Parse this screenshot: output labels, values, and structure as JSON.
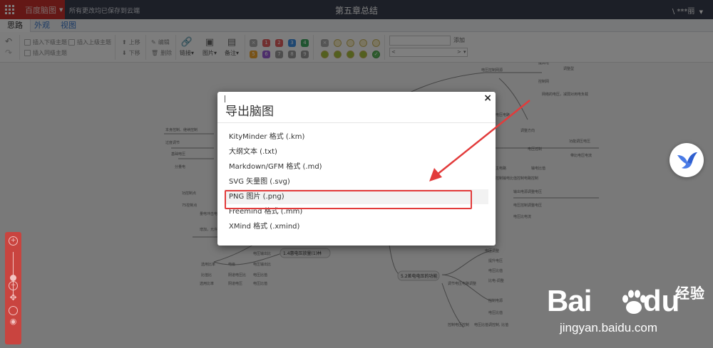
{
  "titlebar": {
    "brand": "百度脑图",
    "save_status": "所有更改均已保存到云端",
    "doc_title": "第五章总结",
    "user": "\\ ***丽"
  },
  "tabs": [
    {
      "label": "思路",
      "active": true
    },
    {
      "label": "外观",
      "active": false
    },
    {
      "label": "视图",
      "active": false
    }
  ],
  "toolbar": {
    "insert_child": "插入下级主题",
    "insert_parent": "插入上级主题",
    "insert_sibling": "插入同级主题",
    "move_up": "上移",
    "move_down": "下移",
    "edit": "编辑",
    "delete": "删除",
    "link": "链接",
    "image": "图片",
    "note": "备注",
    "resource_add": "添加",
    "priorities": [
      "1",
      "2",
      "3",
      "4",
      "5",
      "6",
      "7",
      "8",
      "9"
    ],
    "priority_colors": [
      "#e25f5f",
      "#e25f5f",
      "#3f8ee2",
      "#3fa960",
      "#f0a630",
      "#9a5cd6",
      "#9a9a9a",
      "#9a9a9a",
      "#9a9a9a"
    ],
    "select_left": "<",
    "select_right": ">"
  },
  "modal": {
    "title": "导出脑图",
    "close": "×",
    "formats": [
      "KityMinder 格式 (.km)",
      "大纲文本 (.txt)",
      "Markdown/GFM 格式 (.md)",
      "SVG 矢量图 (.svg)",
      "PNG 图片 (.png)",
      "Freemind 格式 (.mm)",
      "XMind 格式 (.xmind)"
    ],
    "selected_index": 4
  },
  "mindmap": {
    "center_nodes": [
      "1.4惠电压放量(1)林",
      "5.2差电电压的功能"
    ]
  },
  "watermark": {
    "bai": "Bai",
    "du": "du",
    "cn": "经验",
    "url": "jingyan.baidu.com"
  },
  "colors": {
    "titlebar": "#393f4f",
    "brand_red": "#c9302c",
    "tab_link": "#3a77c9",
    "highlight": "#e23b3b",
    "zoom_panel": "#c9443f"
  }
}
